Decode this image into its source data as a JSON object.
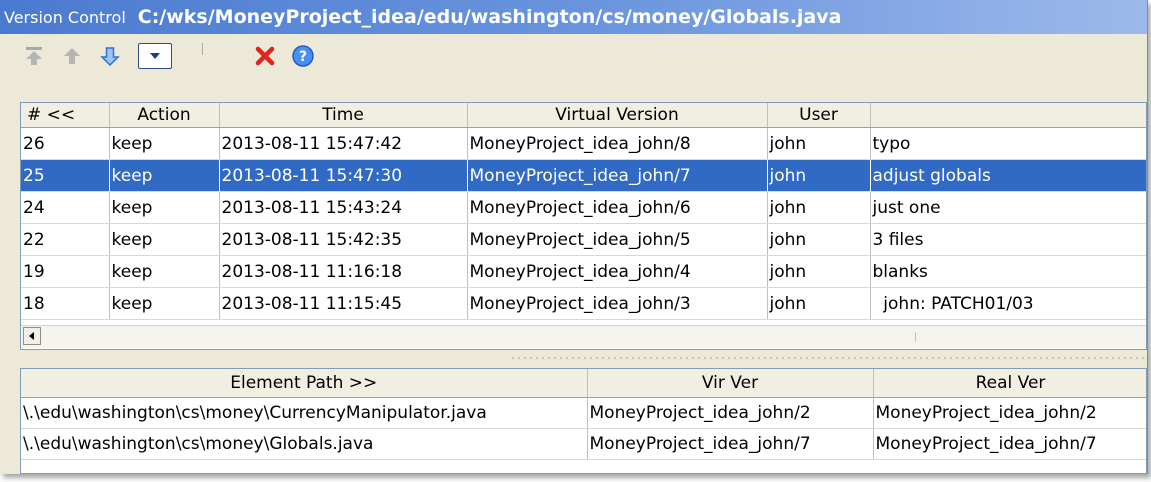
{
  "window": {
    "app_name": "Version Control",
    "file_path": "C:/wks/MoneyProject_idea/edu/washington/cs/money/Globals.java"
  },
  "toolbar": {
    "icons": [
      "first-icon",
      "up-arrow-icon",
      "down-arrow-icon",
      "dropdown-icon",
      "delete-x-icon",
      "help-question-icon"
    ]
  },
  "history": {
    "columns": [
      "# <<",
      "Action",
      "Time",
      "Virtual Version",
      "User",
      ""
    ],
    "rows": [
      {
        "num": "26",
        "action": "keep",
        "time": "2013-08-11 15:47:42",
        "version": "MoneyProject_idea_john/8",
        "user": "john",
        "comment": "typo",
        "selected": false
      },
      {
        "num": "25",
        "action": "keep",
        "time": "2013-08-11 15:47:30",
        "version": "MoneyProject_idea_john/7",
        "user": "john",
        "comment": "adjust globals",
        "selected": true
      },
      {
        "num": "24",
        "action": "keep",
        "time": "2013-08-11 15:43:24",
        "version": "MoneyProject_idea_john/6",
        "user": "john",
        "comment": "just one",
        "selected": false
      },
      {
        "num": "22",
        "action": "keep",
        "time": "2013-08-11 15:42:35",
        "version": "MoneyProject_idea_john/5",
        "user": "john",
        "comment": "3 files",
        "selected": false
      },
      {
        "num": "19",
        "action": "keep",
        "time": "2013-08-11 11:16:18",
        "version": "MoneyProject_idea_john/4",
        "user": "john",
        "comment": "blanks",
        "selected": false
      },
      {
        "num": "18",
        "action": "keep",
        "time": "2013-08-11 11:15:45",
        "version": "MoneyProject_idea_john/3",
        "user": "john",
        "comment": "  john: PATCH01/03",
        "selected": false
      }
    ]
  },
  "elements": {
    "columns": [
      "Element Path >>",
      "Vir Ver",
      "Real Ver"
    ],
    "rows": [
      {
        "path": "\\.\\edu\\washington\\cs\\money\\CurrencyManipulator.java",
        "vir": "MoneyProject_idea_john/2",
        "real": "MoneyProject_idea_john/2"
      },
      {
        "path": "\\.\\edu\\washington\\cs\\money\\Globals.java",
        "vir": "MoneyProject_idea_john/7",
        "real": "MoneyProject_idea_john/7"
      }
    ]
  }
}
